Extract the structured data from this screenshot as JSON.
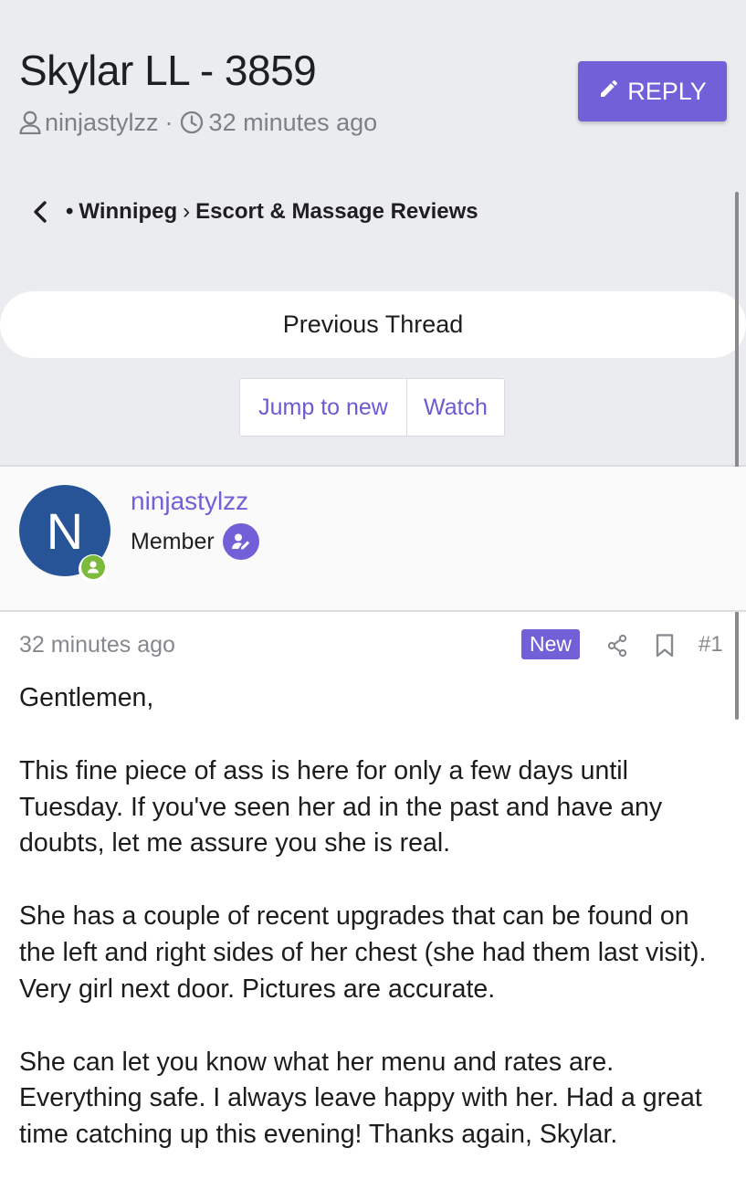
{
  "thread": {
    "title": "Skylar LL - 3859",
    "author": "ninjastylzz",
    "meta_separator": "·",
    "posted_time": "32 minutes ago",
    "reply_label": "REPLY"
  },
  "breadcrumb": {
    "items": [
      "Winnipeg",
      "Escort & Massage Reviews"
    ],
    "separator": "›",
    "lead_dot": "•"
  },
  "navigation": {
    "previous_thread_label": "Previous Thread",
    "jump_to_new_label": "Jump to new",
    "watch_label": "Watch"
  },
  "post_author": {
    "avatar_letter": "N",
    "avatar_color": "#265496",
    "username": "ninjastylzz",
    "role": "Member",
    "online": true
  },
  "post": {
    "time": "32 minutes ago",
    "new_badge": "New",
    "number": "#1",
    "paragraphs": [
      "Gentlemen,",
      "This fine piece of ass is here for only a few days until Tuesday. If you've seen her ad in the past and have any doubts, let me assure you she is real.",
      "She has a couple of recent upgrades that can be found on the left and right sides of her chest (she had them last visit). Very girl next door. Pictures are accurate.",
      "She can let you know what her menu and rates are. Everything safe. I always leave happy with her. Had a great time catching up this evening! Thanks again, Skylar."
    ]
  },
  "icons": {
    "author": "user-icon",
    "time": "clock-icon",
    "reply": "pencil-icon",
    "back": "chevron-left-icon",
    "online": "user-icon",
    "role": "user-edit-icon",
    "share": "share-icon",
    "bookmark": "bookmark-icon"
  },
  "colors": {
    "accent": "#7260d8",
    "online_green": "#7cba3b",
    "background_top": "#ebecef"
  }
}
